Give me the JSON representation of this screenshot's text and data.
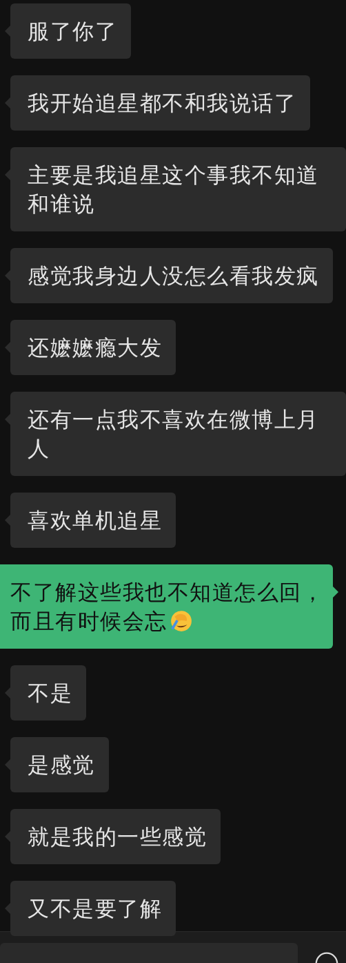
{
  "messages": [
    {
      "kind": "in",
      "text": "服了你了"
    },
    {
      "kind": "in",
      "text": "我开始追星都不和我说话了"
    },
    {
      "kind": "in",
      "text": "主要是我追星这个事我不知道和谁说"
    },
    {
      "kind": "in",
      "text": "感觉我身边人没怎么看我发疯"
    },
    {
      "kind": "in",
      "text": "还嬷嬷瘾大发"
    },
    {
      "kind": "in",
      "text": "还有一点我不喜欢在微博上月人"
    },
    {
      "kind": "in",
      "text": "喜欢单机追星"
    },
    {
      "kind": "out",
      "lines": [
        "不了解这些我也不知道怎么回，",
        "而且有时候会忘"
      ],
      "emoji": true
    },
    {
      "kind": "in",
      "text": "不是"
    },
    {
      "kind": "in",
      "text": "是感觉"
    },
    {
      "kind": "in",
      "text": "就是我的一些感觉"
    },
    {
      "kind": "in",
      "text": "又不是要了解"
    }
  ]
}
